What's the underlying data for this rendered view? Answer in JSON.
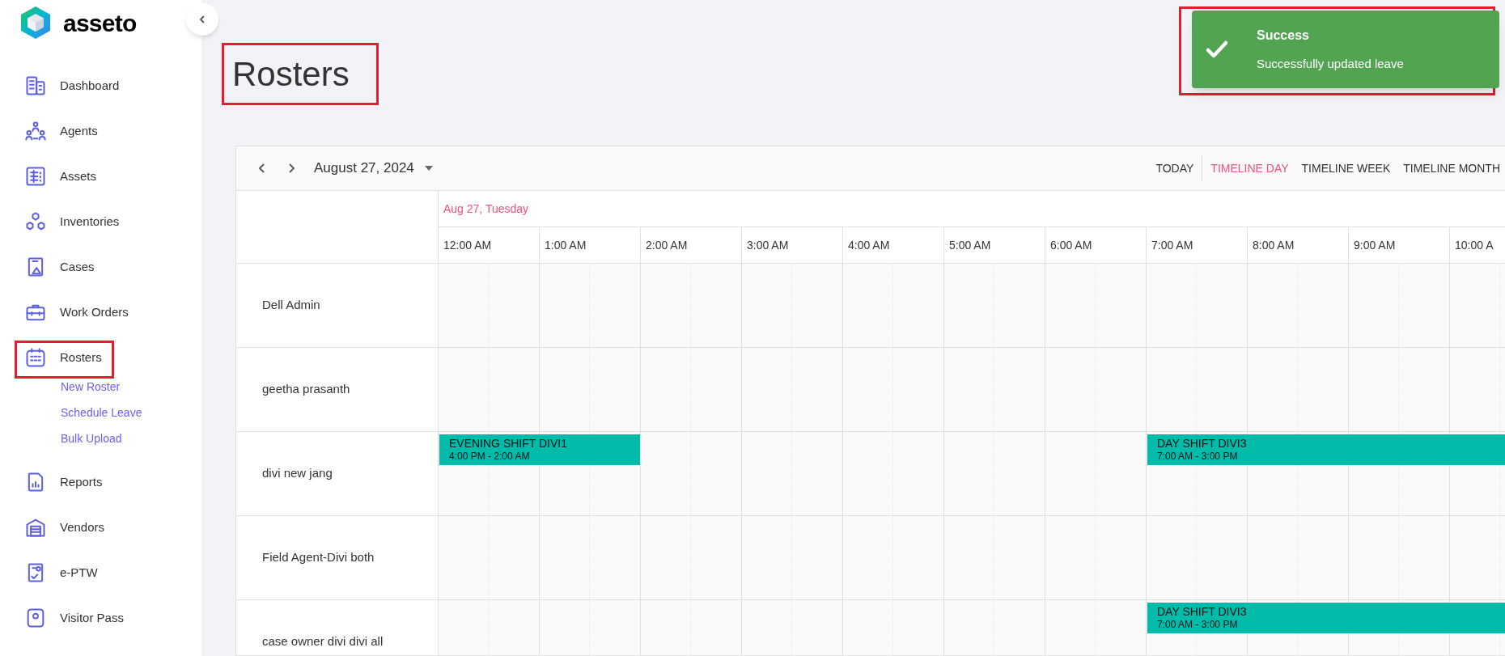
{
  "brand": {
    "name": "asseto"
  },
  "sidebar": {
    "items": [
      {
        "label": "Dashboard",
        "selected": false
      },
      {
        "label": "Agents",
        "selected": false
      },
      {
        "label": "Assets",
        "selected": false
      },
      {
        "label": "Inventories",
        "selected": false
      },
      {
        "label": "Cases",
        "selected": false
      },
      {
        "label": "Work Orders",
        "selected": false
      },
      {
        "label": "Rosters",
        "selected": true,
        "children": [
          {
            "label": "New Roster"
          },
          {
            "label": "Schedule Leave"
          },
          {
            "label": "Bulk Upload"
          }
        ]
      },
      {
        "label": "Reports",
        "selected": false
      },
      {
        "label": "Vendors",
        "selected": false
      },
      {
        "label": "e-PTW",
        "selected": false
      },
      {
        "label": "Visitor Pass",
        "selected": false
      }
    ]
  },
  "page": {
    "title": "Rosters"
  },
  "toast": {
    "title": "Success",
    "message": "Successfully updated leave"
  },
  "scheduler": {
    "date": "August 27, 2024",
    "views": [
      {
        "label": "TODAY",
        "selected": false
      },
      {
        "label": "TIMELINE DAY",
        "selected": true
      },
      {
        "label": "TIMELINE WEEK",
        "selected": false
      },
      {
        "label": "TIMELINE MONTH",
        "selected": false
      }
    ],
    "day_header": "Aug 27, Tuesday",
    "hours": [
      "12:00 AM",
      "1:00 AM",
      "2:00 AM",
      "3:00 AM",
      "4:00 AM",
      "5:00 AM",
      "6:00 AM",
      "7:00 AM",
      "8:00 AM",
      "9:00 AM",
      "10:00 A"
    ],
    "rows": [
      {
        "name": "Dell Admin"
      },
      {
        "name": "geetha prasanth"
      },
      {
        "name": "divi new jang",
        "events": [
          {
            "title": "EVENING SHIFT DIVI1",
            "time": "4:00 PM - 2:00 AM"
          },
          {
            "title": "DAY SHIFT DIVI3",
            "time": "7:00 AM - 3:00 PM"
          }
        ]
      },
      {
        "name": "Field Agent-Divi both"
      },
      {
        "name": "case owner divi divi all",
        "events": [
          {
            "title": "DAY SHIFT DIVI3",
            "time": "7:00 AM - 3:00 PM"
          }
        ]
      }
    ]
  }
}
